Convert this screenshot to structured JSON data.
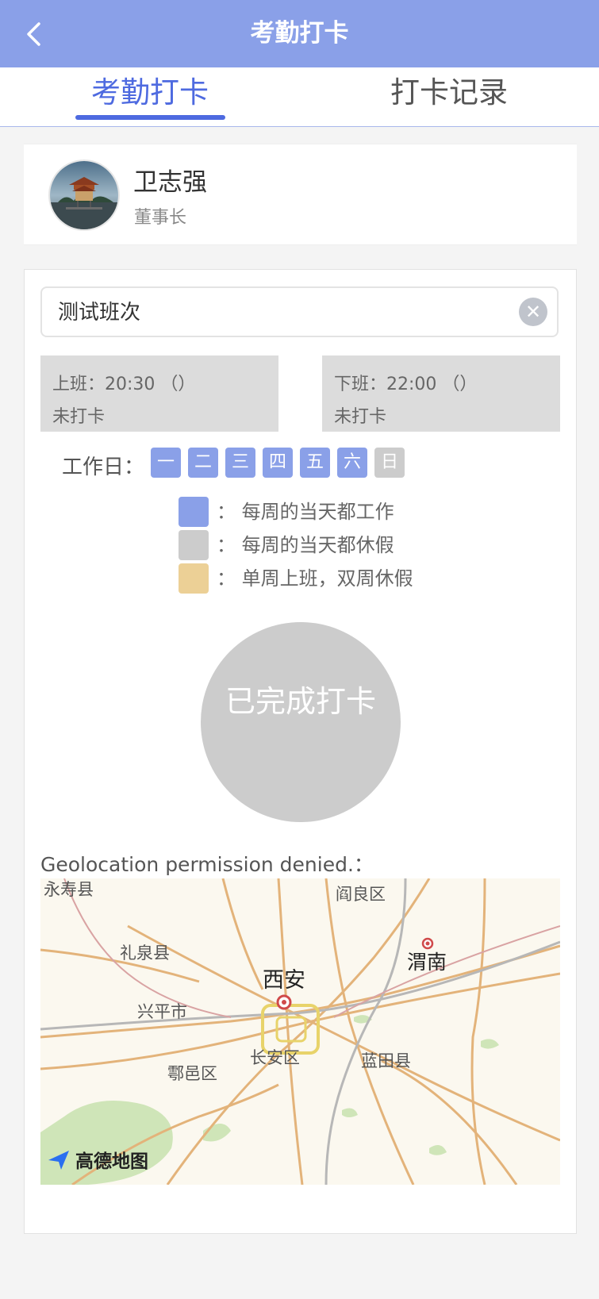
{
  "header": {
    "title": "考勤打卡",
    "back_icon": "chevron-left-icon"
  },
  "tabs": [
    {
      "label": "考勤打卡",
      "active": true
    },
    {
      "label": "打卡记录",
      "active": false
    }
  ],
  "user": {
    "name": "卫志强",
    "role": "董事长"
  },
  "shift": {
    "name": "测试班次",
    "clear_icon": "close-circle-icon"
  },
  "times": {
    "on": {
      "label": "上班：20:30 （）",
      "status": "未打卡"
    },
    "off": {
      "label": "下班：22:00 （）",
      "status": "未打卡"
    }
  },
  "workdays": {
    "label": "工作日：",
    "days": [
      {
        "label": "一",
        "type": "work"
      },
      {
        "label": "二",
        "type": "work"
      },
      {
        "label": "三",
        "type": "work"
      },
      {
        "label": "四",
        "type": "work"
      },
      {
        "label": "五",
        "type": "work"
      },
      {
        "label": "六",
        "type": "work"
      },
      {
        "label": "日",
        "type": "rest"
      }
    ]
  },
  "legend": [
    {
      "text": "： 每周的当天都工作",
      "color": "#8aa0e8"
    },
    {
      "text": "： 每周的当天都休假",
      "color": "#cccccc"
    },
    {
      "text": "： 单周上班，双周休假",
      "color": "#ecd096"
    }
  ],
  "punch": {
    "label": "已完成打卡"
  },
  "geo": {
    "message": "Geolocation permission denied.："
  },
  "map": {
    "labels": [
      "永寿县",
      "阎良区",
      "礼泉县",
      "渭南",
      "西安",
      "兴平市",
      "长安区",
      "蓝田县",
      "鄠邑区"
    ],
    "logo": "高德地图"
  },
  "colors": {
    "accent": "#8aa0e8",
    "tab_active": "#4e6ae0",
    "rest": "#cccccc",
    "alternate": "#ecd096"
  }
}
